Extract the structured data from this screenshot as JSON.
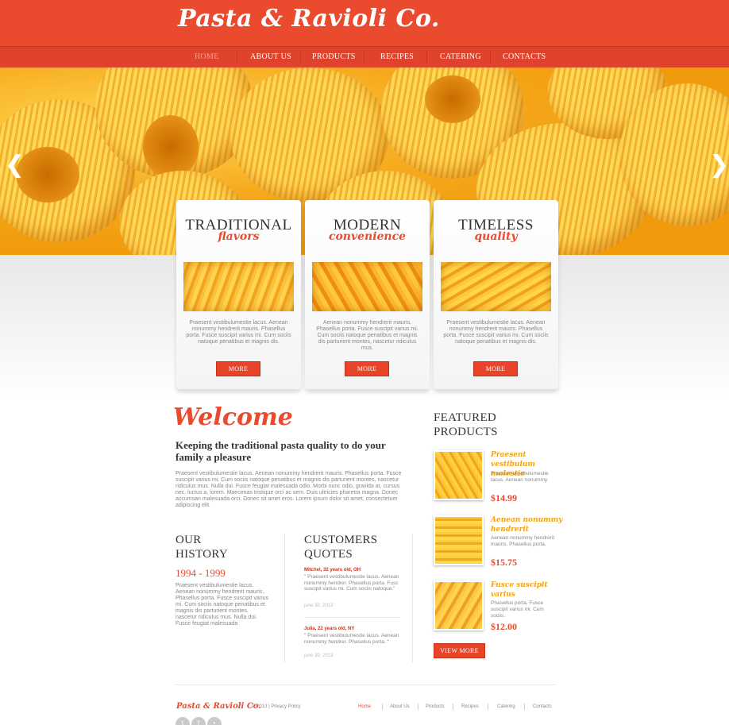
{
  "header": {
    "logo": "Pasta & Ravioli Co."
  },
  "nav": {
    "items": [
      {
        "label": "HOME",
        "active": true
      },
      {
        "label": "ABOUT US"
      },
      {
        "label": "PRODUCTS"
      },
      {
        "label": "RECIPES"
      },
      {
        "label": "CATERING"
      },
      {
        "label": "CONTACTS"
      }
    ]
  },
  "slider": {
    "prev_arrow": "chevron-left-icon",
    "next_arrow": "chevron-right-icon"
  },
  "features": [
    {
      "title": "TRADITIONAL",
      "subtitle": "flavors",
      "text": "Praesent vestibulumestie lacus. Aenean nonummy hendrerit mauris. Phasellus porta. Fusce suscipit varius mi. Cum sociis natoque penatibus et magnis dis.",
      "button": "MORE"
    },
    {
      "title": "MODERN",
      "subtitle": "convenience",
      "text": "Aenean nonummy hendrerit mauris. Phasellus porta. Fusce suscipit varius mi. Cum sociis natoque penatibus et magnis dis parturient montes, nascetur ridiculus mus.",
      "button": "MORE"
    },
    {
      "title": "TIMELESS",
      "subtitle": "quality",
      "text": "Praesent vestibulumestie lacus. Aenean nonummy hendrerit mauris. Phasellus porta. Fusce suscipit varius mi. Cum sociis natoque penatibus et magnis dis.",
      "button": "MORE"
    }
  ],
  "welcome": {
    "title": "Welcome",
    "subtitle": "Keeping the traditional pasta quality to do your family a pleasure",
    "body": "Praesent vestibulumestie lacus. Aenean nonummy hendrerit mauris. Phasellus porta. Fusce suscipit varius mi. Cum sociis natoque penatibus et magnis dis parturient montes, nascetur ridiculus mus. Nulla dui. Fusce feugiat malesuada odio. Morbi nunc odio, gravida at, cursus nec, luctus a, lorem. Maecenas tristique orci ac sem. Duis ultricies pharetra magna. Donec accumsan malesuada orci. Donec sit amet eros. Lorem ipsum dolor sit amet, consectetuer adipiscing elit."
  },
  "history": {
    "title_line1": "OUR",
    "title_line2": "HISTORY",
    "years": "1994 - 1999",
    "body": "Praesent vestibulumestie lacus. Aenean nonummy hendrerit mauris. Phasellus porta. Fusce suscipit varius mi. Cum sociis natoque penatibus et magnis dis parturient montes, nascetur ridiculus mus. Nulla dui. Fusce feugiat malesuada"
  },
  "quotes": {
    "title_line1": "CUSTOMERS",
    "title_line2": "QUOTES",
    "items": [
      {
        "author": "Mitchel, 32 years old, OH",
        "text": "\" Praesent vestibulumestie lacus. Aenean nonummy hendrer. Phasellus porta. Fusc suscipit varius mi. Cum sociis natoque.\"",
        "date": "june 30, 2013"
      },
      {
        "author": "Julia, 22 years old, NY",
        "text": "\" Praesent vestibulumestie lacus. Aenean nonummy hendrer. Phasellus porta. \"",
        "date": "june 30, 2013"
      }
    ]
  },
  "featured": {
    "title_line1": "FEATURED",
    "title_line2": "PRODUCTS",
    "items": [
      {
        "name": "Praesent vestibulum molestie",
        "desc": "Praesent vestibulumestie lacus. Aenean nonummy.",
        "price": "$14.99"
      },
      {
        "name": "Aenean nonummy hendrerit",
        "desc": "Aenean nonummy hendrerit mauris. Phasellus porta.",
        "price": "$15.75"
      },
      {
        "name": "Fusce suscipit varius",
        "desc": "Phasellus porta. Fusce suscipit varius mi. Cum sociis.",
        "price": "$12.00"
      }
    ],
    "button": "VIEW MORE"
  },
  "footer": {
    "logo": "Pasta & Ravioli Co.",
    "copyright": "© 2013 | Privacy Policy",
    "links": [
      "Home",
      "About Us",
      "Products",
      "Recipes",
      "Catering",
      "Contacts"
    ],
    "social": [
      "twitter-icon",
      "facebook-icon",
      "rss-icon"
    ]
  }
}
